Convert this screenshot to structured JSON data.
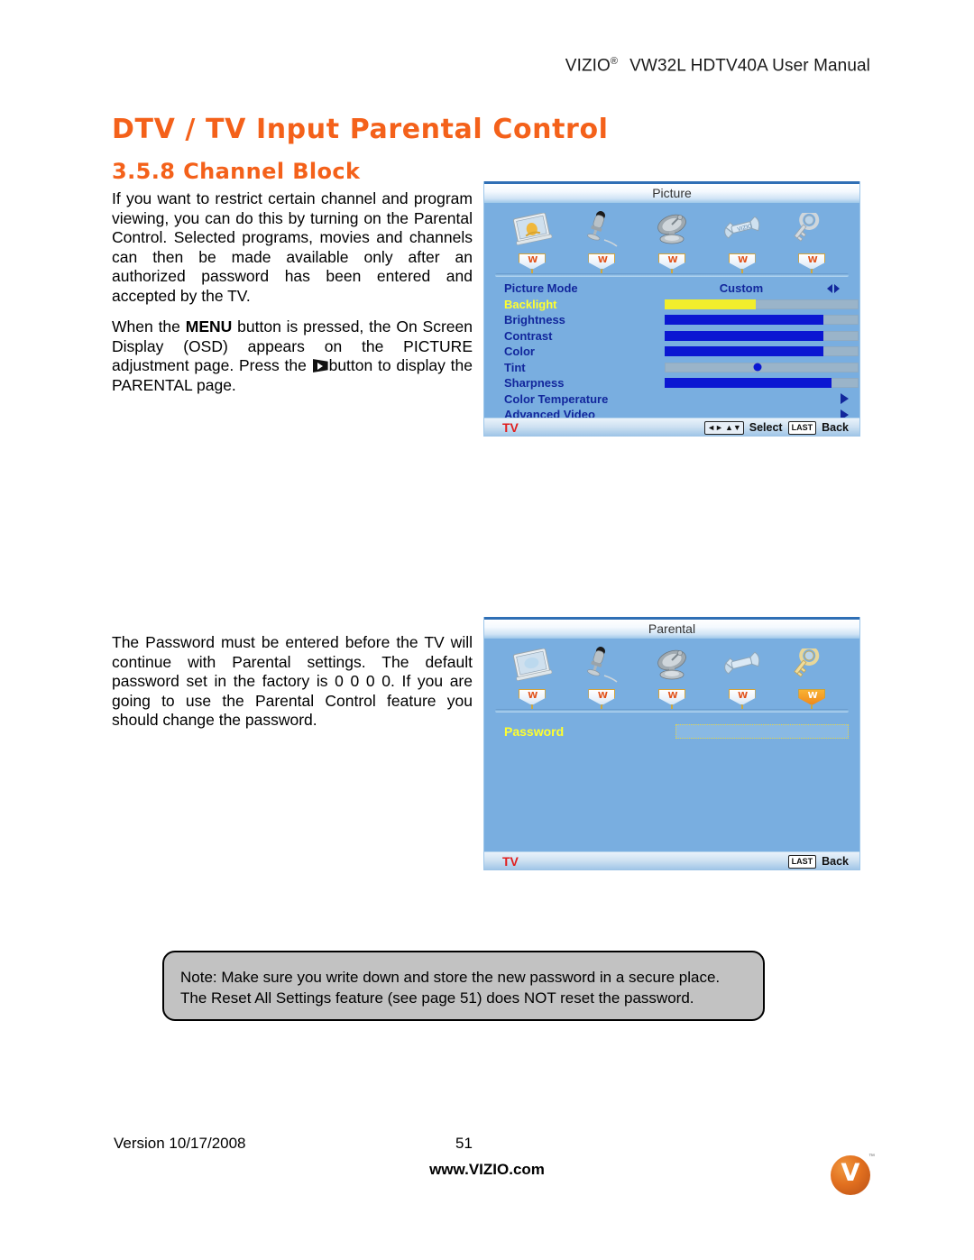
{
  "header": {
    "brand": "VIZIO",
    "registered": "®",
    "model_line": "VW32L HDTV40A User Manual"
  },
  "headings": {
    "h1": "DTV / TV Input Parental Control",
    "h2": "3.5.8 Channel Block"
  },
  "paragraphs": {
    "p1": "If you want to restrict certain channel and program viewing, you can do this by turning on the Parental Control.  Selected programs, movies and channels can then be made available only after an authorized password has been entered and accepted by the TV.",
    "p2_a": "When the ",
    "p2_menu": "MENU",
    "p2_b": " button is pressed, the On Screen Display (OSD) appears on the PICTURE adjustment page.  Press the ",
    "p2_c": "button to display the PARENTAL page.",
    "p3": "The Password must be entered before the TV will continue with Parental settings.   The default password set in the factory is 0 0 0 0.  If you are going to use the Parental Control feature you should change the password."
  },
  "osd_picture": {
    "title": "Picture",
    "icons": [
      {
        "name": "picture-icon",
        "label": "Picture",
        "selected": false
      },
      {
        "name": "audio-microphone-icon",
        "label": "Audio",
        "selected": false
      },
      {
        "name": "satellite-dish-icon",
        "label": "Tuner",
        "selected": false
      },
      {
        "name": "wrench-setup-icon",
        "label": "Setup",
        "selected": false
      },
      {
        "name": "key-parental-icon",
        "label": "Parental",
        "selected": false
      }
    ],
    "rows": [
      {
        "label": "Picture Mode",
        "type": "option",
        "value": "Custom",
        "control": "lr",
        "selected": false
      },
      {
        "label": "Backlight",
        "type": "slider",
        "value": "50",
        "percent": 47,
        "fill": "yellow",
        "selected": true
      },
      {
        "label": "Brightness",
        "type": "slider",
        "value": "80",
        "percent": 82,
        "fill": "blue",
        "selected": false
      },
      {
        "label": "Contrast",
        "type": "slider",
        "value": "80",
        "percent": 82,
        "fill": "blue",
        "selected": false
      },
      {
        "label": "Color",
        "type": "slider",
        "value": "80",
        "percent": 82,
        "fill": "blue",
        "selected": false
      },
      {
        "label": "Tint",
        "type": "dot",
        "value": "0",
        "percent": 48,
        "fill": "blue",
        "selected": false
      },
      {
        "label": "Sharpness",
        "type": "slider",
        "value": "6",
        "percent": 86,
        "fill": "blue",
        "selected": false
      },
      {
        "label": "Color Temperature",
        "type": "submenu",
        "value": "",
        "control": "right",
        "selected": false
      },
      {
        "label": "Advanced Video",
        "type": "submenu",
        "value": "",
        "control": "right",
        "selected": false
      }
    ],
    "footer": {
      "source": "TV",
      "select_label": "Select",
      "last_key": "LAST",
      "back_label": "Back"
    }
  },
  "osd_parental": {
    "title": "Parental",
    "icons": [
      {
        "name": "picture-icon",
        "label": "Picture",
        "selected": false
      },
      {
        "name": "audio-microphone-icon",
        "label": "Audio",
        "selected": false
      },
      {
        "name": "satellite-dish-icon",
        "label": "Tuner",
        "selected": false
      },
      {
        "name": "wrench-setup-icon",
        "label": "Setup",
        "selected": false
      },
      {
        "name": "key-parental-icon",
        "label": "Parental",
        "selected": true
      }
    ],
    "password_label": "Password",
    "password_value": "",
    "footer": {
      "source": "TV",
      "last_key": "LAST",
      "back_label": "Back"
    }
  },
  "note": {
    "line1": "Note: Make sure you write down and store the new password in a secure place.",
    "line2": "The Reset All Settings feature (see page 51) does NOT reset the password."
  },
  "footer": {
    "version": "Version 10/17/2008",
    "page_number": "51",
    "url": "www.VIZIO.com",
    "logo_letter": "V",
    "logo_tm": "™"
  },
  "colors": {
    "accent_orange": "#F4611A",
    "osd_blue": "#79AEE0",
    "osd_text_blue": "#12279C",
    "osd_highlight_yellow": "#FFFF2E",
    "osd_source_red": "#E01E1E",
    "slider_blue": "#0B17D2",
    "slider_yellow": "#F2EE2C"
  }
}
